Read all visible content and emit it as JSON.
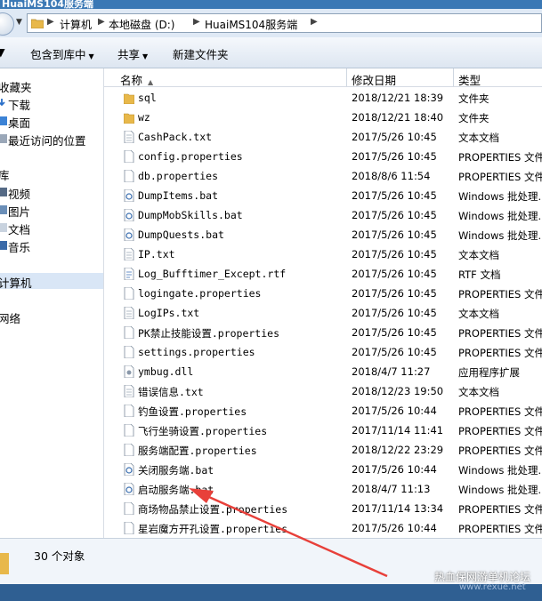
{
  "window": {
    "title": "HuaiMS104服务端"
  },
  "address": {
    "crumbs": [
      "计算机",
      "本地磁盘 (D:)",
      "HuaiMS104服务端"
    ]
  },
  "toolbar": {
    "include_label": "包含到库中",
    "share_label": "共享",
    "new_folder_label": "新建文件夹"
  },
  "nav": {
    "favorites_label": "收藏夹",
    "favorites": [
      "下载",
      "桌面",
      "最近访问的位置"
    ],
    "libraries_label": "库",
    "libraries": [
      "视频",
      "图片",
      "文档",
      "音乐"
    ],
    "computer_label": "计算机",
    "network_label": "网络"
  },
  "columns": {
    "name": "名称",
    "date": "修改日期",
    "type": "类型"
  },
  "files": [
    {
      "name": "sql",
      "date": "2018/12/21 18:39",
      "type": "文件夹",
      "icon": "folder-icon"
    },
    {
      "name": "wz",
      "date": "2018/12/21 18:40",
      "type": "文件夹",
      "icon": "folder-icon"
    },
    {
      "name": "CashPack.txt",
      "date": "2017/5/26 10:45",
      "type": "文本文档",
      "icon": "text-file-icon"
    },
    {
      "name": "config.properties",
      "date": "2017/5/26 10:45",
      "type": "PROPERTIES 文件",
      "icon": "file-icon"
    },
    {
      "name": "db.properties",
      "date": "2018/8/6 11:54",
      "type": "PROPERTIES 文件",
      "icon": "file-icon"
    },
    {
      "name": "DumpItems.bat",
      "date": "2017/5/26 10:45",
      "type": "Windows 批处理...",
      "icon": "batch-file-icon"
    },
    {
      "name": "DumpMobSkills.bat",
      "date": "2017/5/26 10:45",
      "type": "Windows 批处理...",
      "icon": "batch-file-icon"
    },
    {
      "name": "DumpQuests.bat",
      "date": "2017/5/26 10:45",
      "type": "Windows 批处理...",
      "icon": "batch-file-icon"
    },
    {
      "name": "IP.txt",
      "date": "2017/5/26 10:45",
      "type": "文本文档",
      "icon": "text-file-icon"
    },
    {
      "name": "Log_Bufftimer_Except.rtf",
      "date": "2017/5/26 10:45",
      "type": "RTF 文档",
      "icon": "rtf-file-icon"
    },
    {
      "name": "logingate.properties",
      "date": "2017/5/26 10:45",
      "type": "PROPERTIES 文件",
      "icon": "file-icon"
    },
    {
      "name": "LogIPs.txt",
      "date": "2017/5/26 10:45",
      "type": "文本文档",
      "icon": "text-file-icon"
    },
    {
      "name": "PK禁止技能设置.properties",
      "date": "2017/5/26 10:45",
      "type": "PROPERTIES 文件",
      "icon": "file-icon"
    },
    {
      "name": "settings.properties",
      "date": "2017/5/26 10:45",
      "type": "PROPERTIES 文件",
      "icon": "file-icon"
    },
    {
      "name": "ymbug.dll",
      "date": "2018/4/7 11:27",
      "type": "应用程序扩展",
      "icon": "dll-file-icon"
    },
    {
      "name": "错误信息.txt",
      "date": "2018/12/23 19:50",
      "type": "文本文档",
      "icon": "text-file-icon"
    },
    {
      "name": "钓鱼设置.properties",
      "date": "2017/5/26 10:44",
      "type": "PROPERTIES 文件",
      "icon": "file-icon"
    },
    {
      "name": "飞行坐骑设置.properties",
      "date": "2017/11/14 11:41",
      "type": "PROPERTIES 文件",
      "icon": "file-icon"
    },
    {
      "name": "服务端配置.properties",
      "date": "2018/12/22 23:29",
      "type": "PROPERTIES 文件",
      "icon": "file-icon"
    },
    {
      "name": "关闭服务端.bat",
      "date": "2017/5/26 10:44",
      "type": "Windows 批处理...",
      "icon": "batch-file-icon"
    },
    {
      "name": "启动服务端.bat",
      "date": "2018/4/7 11:13",
      "type": "Windows 批处理...",
      "icon": "batch-file-icon"
    },
    {
      "name": "商场物品禁止设置.properties",
      "date": "2017/11/14 13:34",
      "type": "PROPERTIES 文件",
      "icon": "file-icon"
    },
    {
      "name": "星岩魔方开孔设置.properties",
      "date": "2017/5/26 10:44",
      "type": "PROPERTIES 文件",
      "icon": "file-icon"
    }
  ],
  "status": {
    "count_text": "30 个对象"
  },
  "watermark": {
    "text": "热血保网游单机论坛",
    "site": "www.rexue.net"
  },
  "colors": {
    "folder": "#e8b84a",
    "accent": "#3a78b5",
    "annotation_arrow": "#e8403a"
  }
}
